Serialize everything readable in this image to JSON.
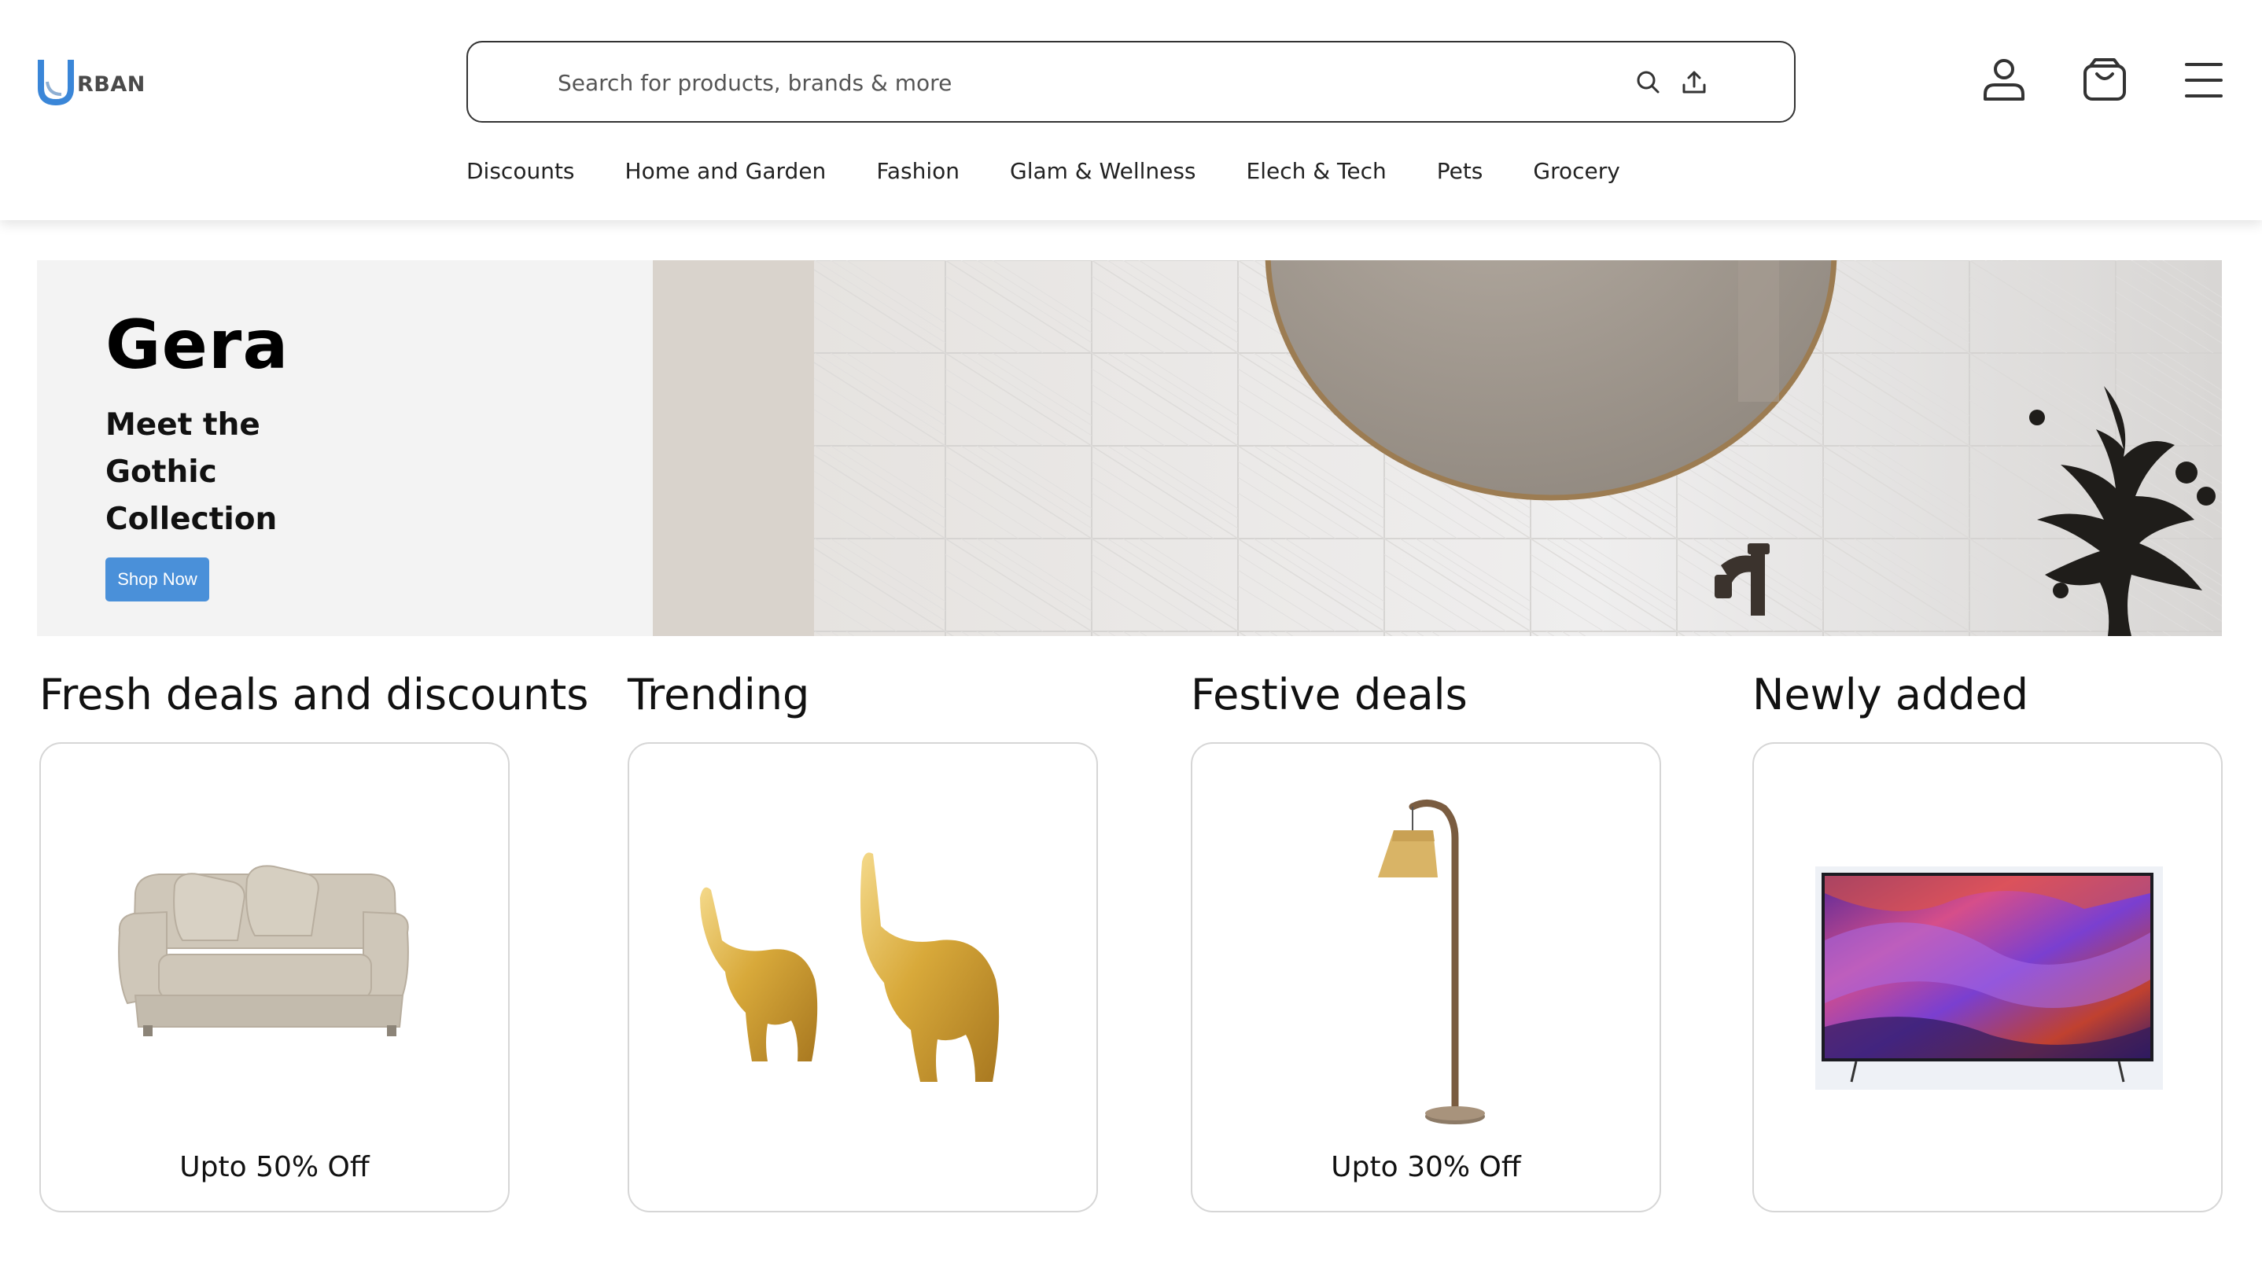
{
  "brand": {
    "logo_letter": "U",
    "name": "RBAN",
    "accent": "#3a86d8"
  },
  "search": {
    "placeholder": "Search for products, brands & more",
    "value": "",
    "icons": [
      "search-icon",
      "upload-icon"
    ]
  },
  "header_icons": [
    "user-icon",
    "shopping-bag-icon",
    "hamburger-menu-icon"
  ],
  "nav": {
    "items": [
      {
        "label": "Discounts"
      },
      {
        "label": "Home and Garden"
      },
      {
        "label": "Fashion"
      },
      {
        "label": "Glam & Wellness"
      },
      {
        "label": "Elech & Tech"
      },
      {
        "label": "Pets"
      },
      {
        "label": "Grocery"
      }
    ]
  },
  "hero": {
    "title": "Gera",
    "subtitle": "Meet the Gothic Collection",
    "button_label": "Shop Now",
    "button_color": "#4a90d9"
  },
  "sections": [
    {
      "title": "Fresh deals and discounts",
      "caption": "Upto 50% Off",
      "image": "sofa"
    },
    {
      "title": "Trending",
      "caption": "",
      "image": "gold-elephant-figurines"
    },
    {
      "title": "Festive deals",
      "caption": "Upto 30% Off",
      "image": "floor-lamp"
    },
    {
      "title": "Newly added",
      "caption": "",
      "image": "television"
    }
  ]
}
